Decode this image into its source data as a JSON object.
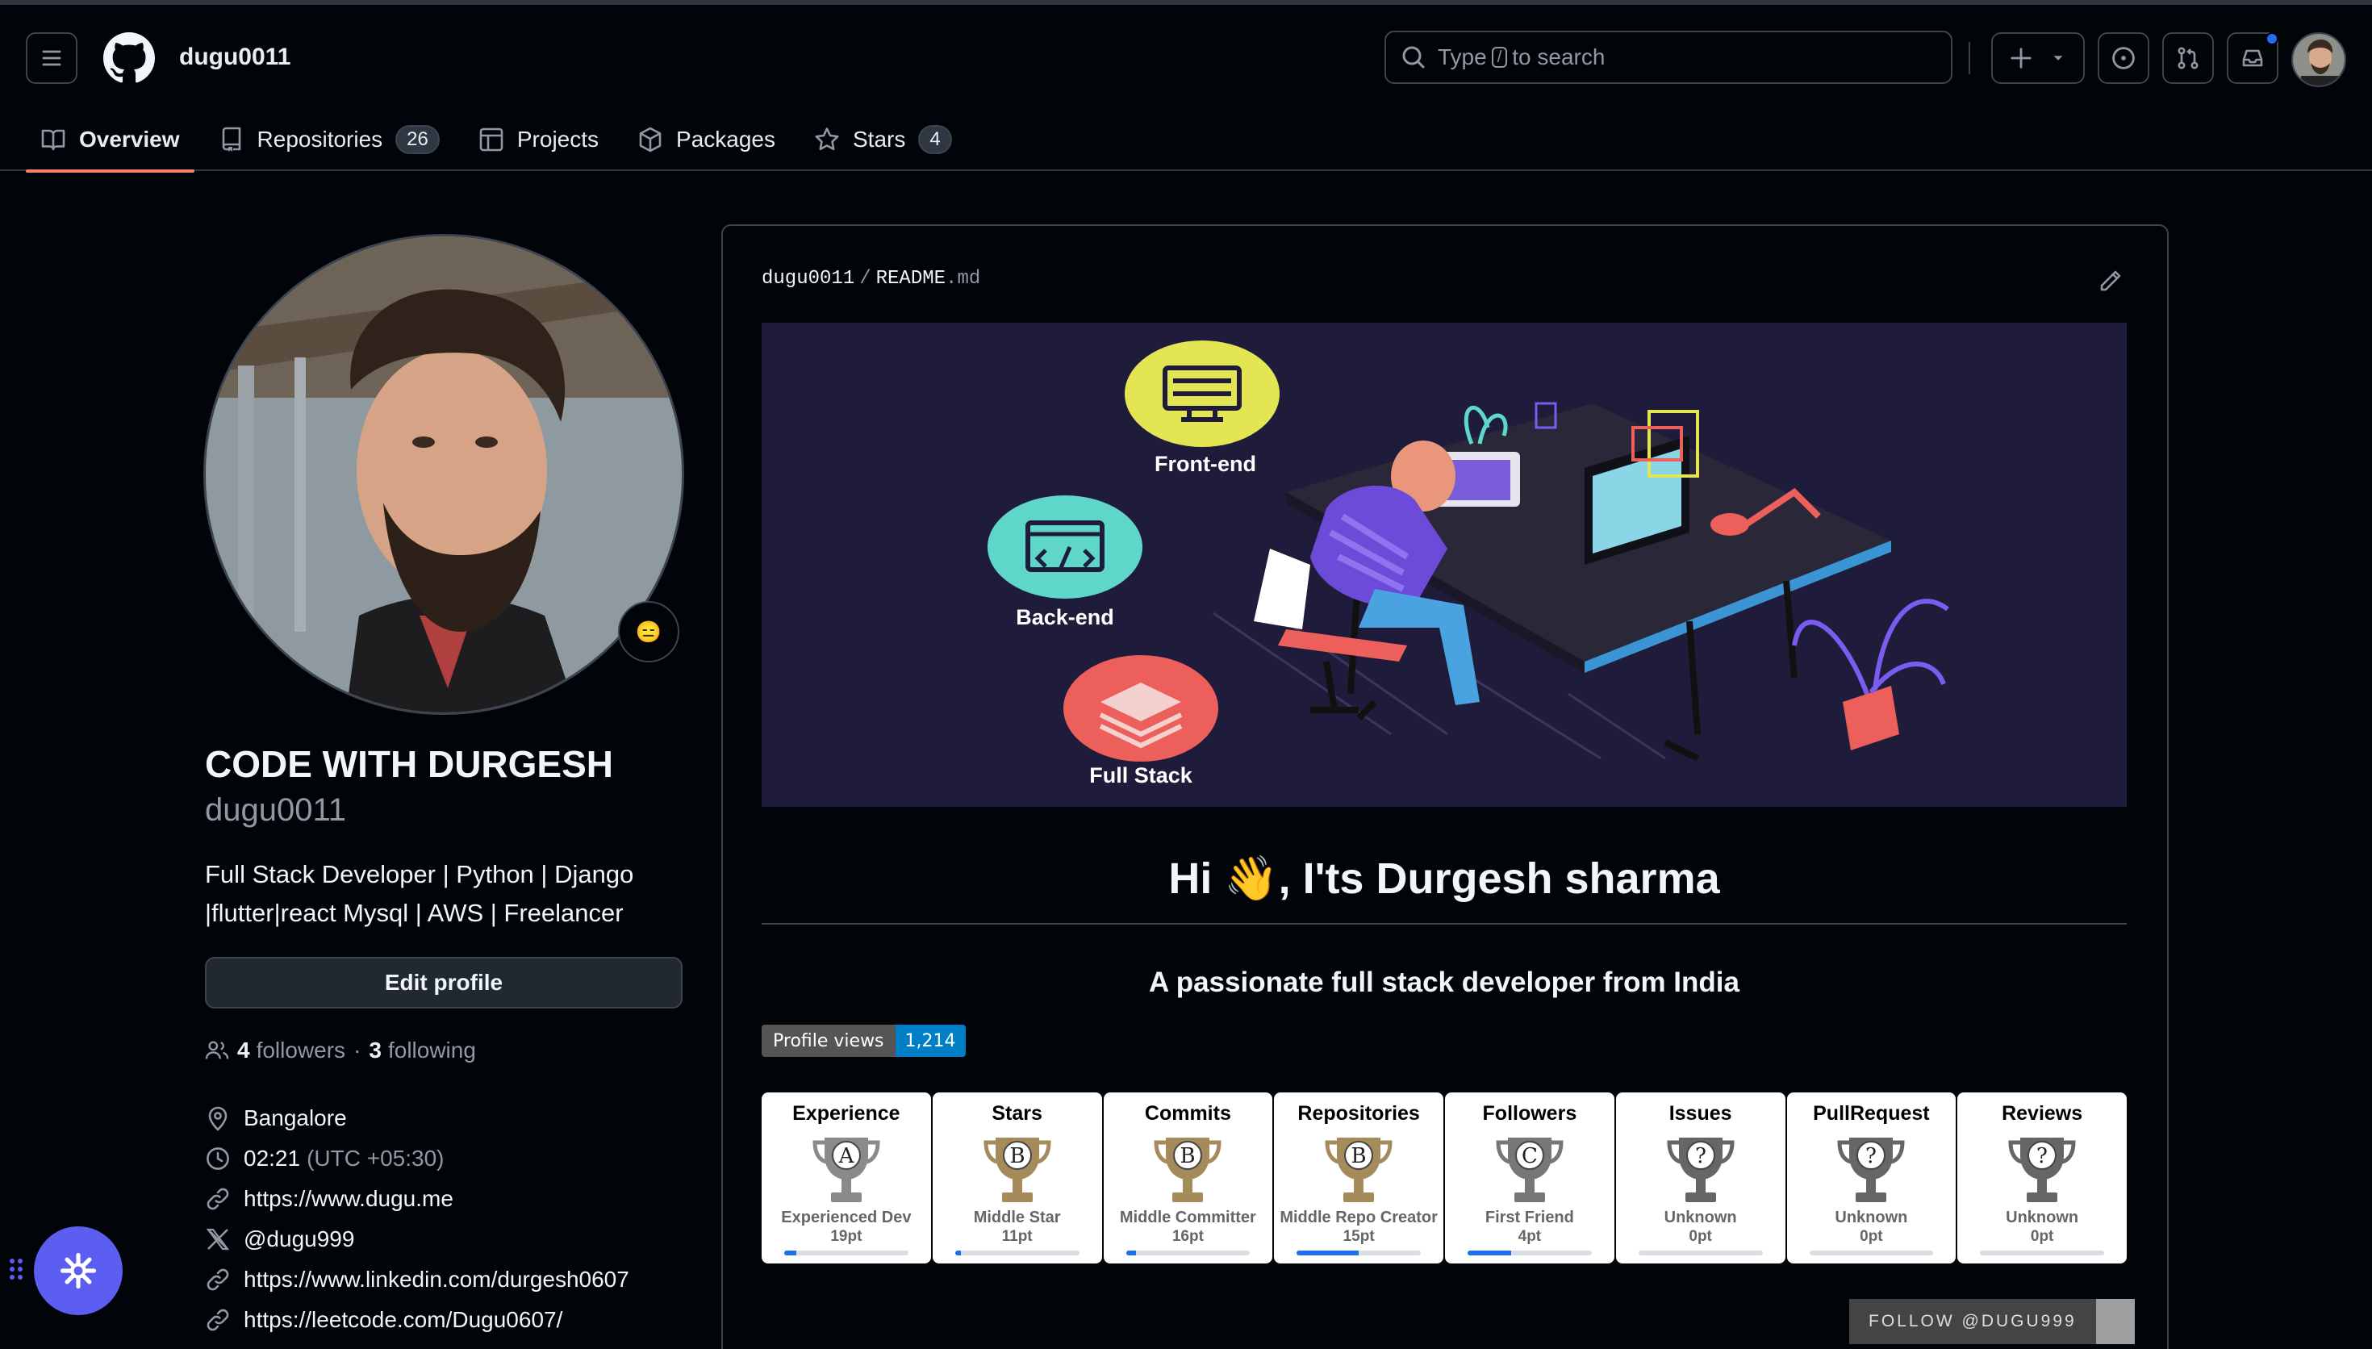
{
  "header": {
    "username": "dugu0011",
    "search": {
      "pre": "Type",
      "key": "/",
      "post": "to search"
    }
  },
  "tabs": [
    {
      "label": "Overview",
      "count": null
    },
    {
      "label": "Repositories",
      "count": "26"
    },
    {
      "label": "Projects",
      "count": null
    },
    {
      "label": "Packages",
      "count": null
    },
    {
      "label": "Stars",
      "count": "4"
    }
  ],
  "profile": {
    "display_name": "CODE WITH DURGESH",
    "login": "dugu0011",
    "bio_line1": "Full Stack Developer | Python | Django",
    "bio_line2": "|flutter|react Mysql | AWS | Freelancer",
    "edit_label": "Edit profile",
    "followers_count": "4",
    "followers_label": "followers",
    "dot": "·",
    "following_count": "3",
    "following_label": "following",
    "location": "Bangalore",
    "local_time": "02:21",
    "timezone": "(UTC +05:30)",
    "website": "https://www.dugu.me",
    "twitter": "@dugu999",
    "linkedin": "https://www.linkedin.com/durgesh0607",
    "leetcode": "https://leetcode.com/Dugu0607/"
  },
  "readme": {
    "owner": "dugu0011",
    "sep": "/",
    "file_base": "README",
    "file_ext": ".md",
    "banner": {
      "frontend": "Front-end",
      "backend": "Back-end",
      "fullstack": "Full Stack"
    },
    "heading": "Hi 👋, I'ts Durgesh sharma",
    "tagline": "A passionate full stack developer from India",
    "views_label": "Profile views",
    "views_value": "1,214",
    "trophies": [
      {
        "title": "Experience",
        "rank": "A",
        "name": "Experienced Dev",
        "points": "19pt",
        "progress": 0.1,
        "color": "#8a8a8a"
      },
      {
        "title": "Stars",
        "rank": "B",
        "name": "Middle Star",
        "points": "11pt",
        "progress": 0.05,
        "color": "#a58b5c"
      },
      {
        "title": "Commits",
        "rank": "B",
        "name": "Middle Committer",
        "points": "16pt",
        "progress": 0.08,
        "color": "#a58b5c"
      },
      {
        "title": "Repositories",
        "rank": "B",
        "name": "Middle Repo Creator",
        "points": "15pt",
        "progress": 0.5,
        "color": "#a58b5c"
      },
      {
        "title": "Followers",
        "rank": "C",
        "name": "First Friend",
        "points": "4pt",
        "progress": 0.35,
        "color": "#777777"
      },
      {
        "title": "Issues",
        "rank": "?",
        "name": "Unknown",
        "points": "0pt",
        "progress": 0,
        "color": "#666666"
      },
      {
        "title": "PullRequest",
        "rank": "?",
        "name": "Unknown",
        "points": "0pt",
        "progress": 0,
        "color": "#666666"
      },
      {
        "title": "Reviews",
        "rank": "?",
        "name": "Unknown",
        "points": "0pt",
        "progress": 0,
        "color": "#666666"
      }
    ],
    "follow_badge": "FOLLOW @DUGU999"
  },
  "colors": {
    "accent_tab": "#f78166",
    "fab": "#5b5ef0",
    "views_badge": "#007ec6"
  }
}
